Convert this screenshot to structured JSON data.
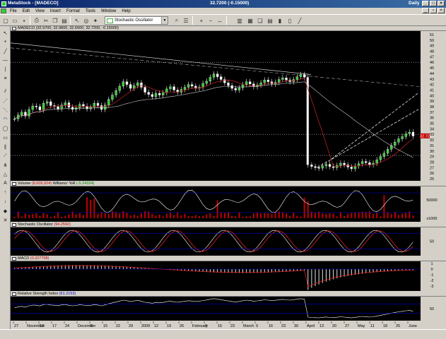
{
  "window": {
    "title": "MetaStock - [MADECO]",
    "quote": "32.7200 (-0.15000)",
    "period": "Daily"
  },
  "menu": [
    "File",
    "Edit",
    "View",
    "Insert",
    "Format",
    "Tools",
    "Window",
    "Help"
  ],
  "toolbar": {
    "indicator_select": "Stochastic Oscillator"
  },
  "panes": {
    "price": {
      "name": "MADECO",
      "values": "(32.9700, 32.9800, 32.6600, 32.7200, -0.15000)",
      "last_value": "32.7200"
    },
    "volume": {
      "name": "Volume",
      "value": "(8,009,924)",
      "name2": "Williams' %R",
      "value2": "(-5.24324)"
    },
    "stochastic": {
      "name": "Stochastic Oscillator",
      "value": "(94.2592)"
    },
    "macd": {
      "name": "MACD",
      "value": "(0.327798)"
    },
    "rsi": {
      "name": "Relative Strength Index",
      "value": "(61.2153)"
    }
  },
  "price_axis_ticks": [
    "51",
    "50",
    "49",
    "48",
    "47",
    "46",
    "45",
    "44",
    "43",
    "42",
    "41",
    "40",
    "39",
    "38",
    "37",
    "36",
    "35",
    "34",
    "33",
    "32",
    "31",
    "30",
    "29",
    "28",
    "27",
    "26",
    "25"
  ],
  "volume_axis_ticks": [
    "50000",
    "x1000"
  ],
  "stoch_axis_ticks": [
    "50"
  ],
  "macd_axis_ticks": [
    "1",
    "0",
    "-1",
    "-2",
    "-3"
  ],
  "rsi_axis_ticks": [
    "50"
  ],
  "x_axis_ticks": [
    "27",
    "November",
    "10",
    "17",
    "24",
    "December",
    "8",
    "15",
    "22",
    "29",
    "2009",
    "12",
    "19",
    "26",
    "February",
    "9",
    "16",
    "23",
    "March",
    "9",
    "16",
    "23",
    "30",
    "April",
    "13",
    "20",
    "27",
    "May",
    "11",
    "18",
    "25",
    "June"
  ],
  "chart_data": {
    "type": "candlestick",
    "symbol": "MADECO",
    "price_ylim": [
      25,
      51
    ],
    "last": 32.72,
    "change": -0.15,
    "trend": [
      35.8,
      36.5,
      37.0,
      36.3,
      37.5,
      38.1,
      38.0,
      37.4,
      38.6,
      38.9,
      38.2,
      38.0,
      37.6,
      38.3,
      38.7,
      37.9,
      37.5,
      37.8,
      38.4,
      38.1,
      37.6,
      37.9,
      38.6,
      38.2,
      37.5,
      38.3,
      39.3,
      40.1,
      40.9,
      41.7,
      42.5,
      42.0,
      41.3,
      41.8,
      42.3,
      41.5,
      40.6,
      40.2,
      39.8,
      40.4,
      40.1,
      40.5,
      41.2,
      41.6,
      41.0,
      40.6,
      41.1,
      41.5,
      42.0,
      41.7,
      41.3,
      41.5,
      42.2,
      42.6,
      43.3,
      43.9,
      43.4,
      42.9,
      42.3,
      41.8,
      41.3,
      41.0,
      41.4,
      42.0,
      42.5,
      42.1,
      41.6,
      41.9,
      42.3,
      42.8,
      42.5,
      42.1,
      42.4,
      42.9,
      43.2,
      42.8,
      42.5,
      42.9,
      43.4,
      43.8,
      43.3,
      27.5,
      27.2,
      27.0,
      26.9,
      27.3,
      27.6,
      27.2,
      27.0,
      27.4,
      27.8,
      27.5,
      27.1,
      26.8,
      27.3,
      27.7,
      28.1,
      27.9,
      27.5,
      27.8,
      28.4,
      29.0,
      29.6,
      30.3,
      31.0,
      31.6,
      32.2,
      32.6,
      33.1,
      33.4,
      32.7
    ]
  }
}
